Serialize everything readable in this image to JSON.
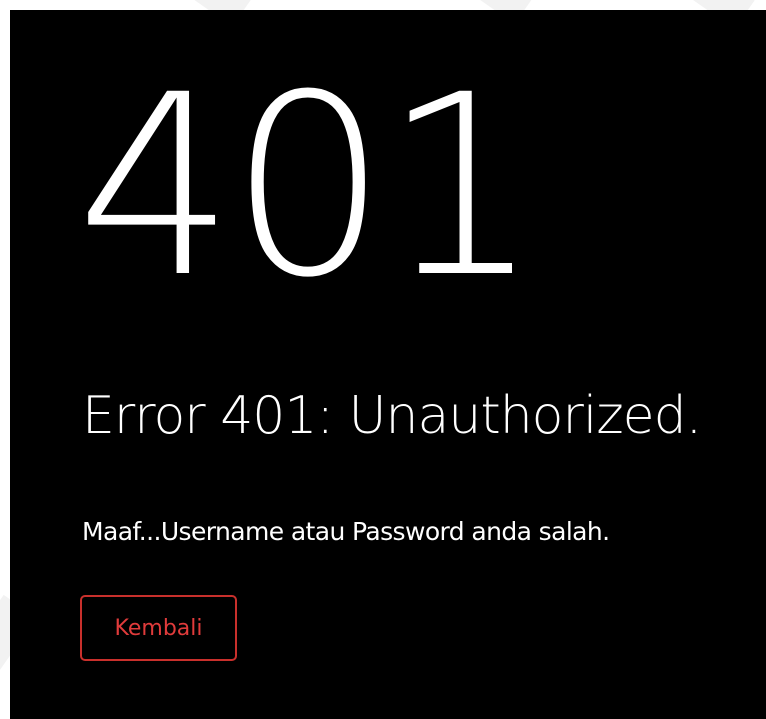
{
  "error": {
    "code": "401",
    "title": "Error 401: Unauthorized.",
    "message": "Maaf...Username atau Password anda salah."
  },
  "actions": {
    "back_label": "Kembali"
  },
  "colors": {
    "background": "#000000",
    "text": "#ffffff",
    "button_border": "#c9302c",
    "button_text": "#e03b3b"
  }
}
